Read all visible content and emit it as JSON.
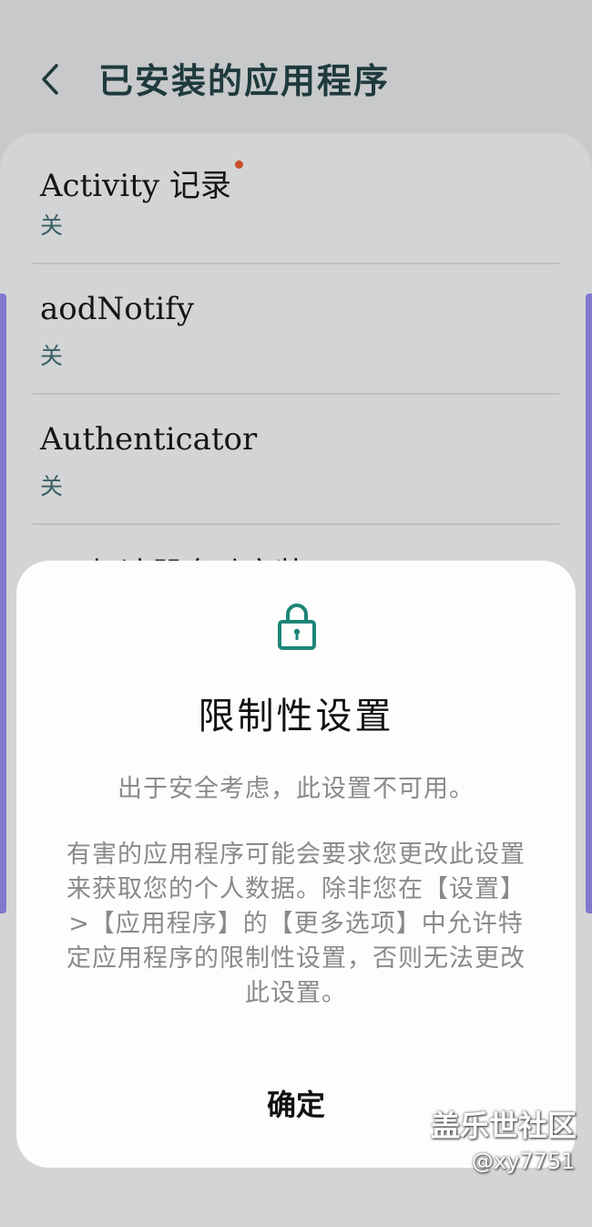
{
  "header": {
    "title": "已安装的应用程序"
  },
  "apps": [
    {
      "name": "Activity 记录",
      "status": "关"
    },
    {
      "name": "aodNotify",
      "status": "关"
    },
    {
      "name": "Authenticator",
      "status": "关"
    }
  ],
  "partial_item": "GG加速器自动安装",
  "dialog": {
    "icon": "lock-icon",
    "title": "限制性设置",
    "message_line1": "出于安全考虑，此设置不可用。",
    "message_line2": "有害的应用程序可能会要求您更改此设置来获取您的个人数据。除非您在【设置】>【应用程序】的【更多选项】中允许特定应用程序的限制性设置，否则无法更改此设置。",
    "ok_label": "确定"
  },
  "watermark": {
    "site": "盖乐世社区",
    "user": "@xy7751"
  },
  "colors": {
    "accent": "#1d8577",
    "notification_dot": "#c8512a",
    "scrollbar": "#7f78cf"
  }
}
